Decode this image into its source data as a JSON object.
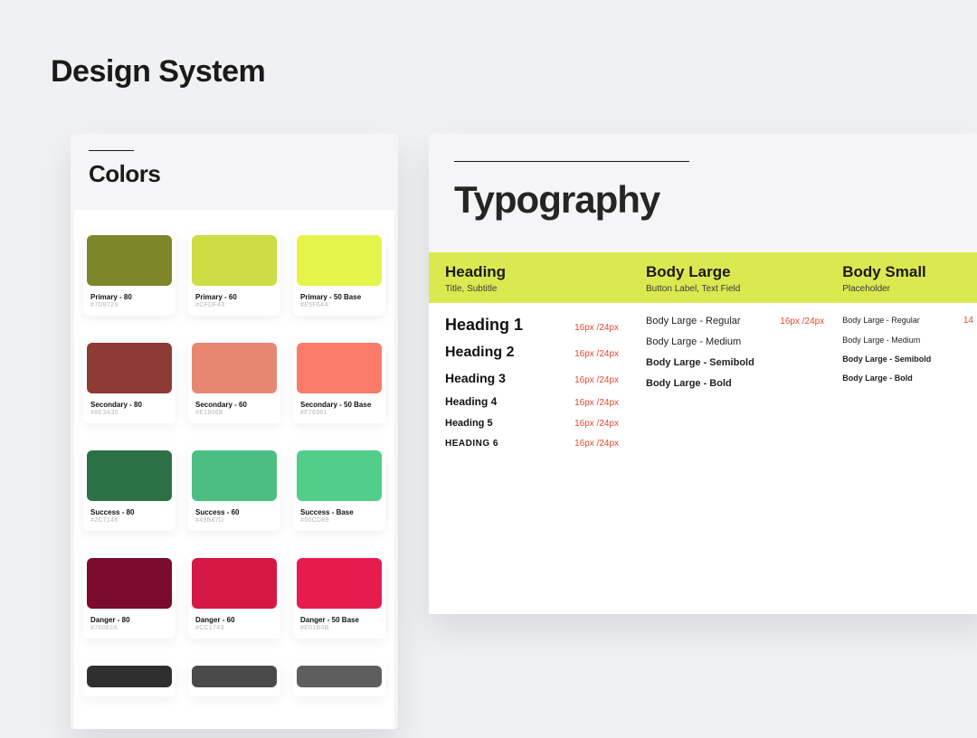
{
  "page_title": "Design System",
  "colors_section": {
    "title": "Colors",
    "rows": [
      [
        {
          "name": "Primary - 80",
          "hex": "#7D8729",
          "chip": "#7D8729"
        },
        {
          "name": "Primary - 60",
          "hex": "#CFDF43",
          "chip": "#CDDE44"
        },
        {
          "name": "Primary - 50 Base",
          "hex": "#E5F64A",
          "chip": "#E4F44B"
        }
      ],
      [
        {
          "name": "Secondary - 80",
          "hex": "#8E3A35",
          "chip": "#8E3A35"
        },
        {
          "name": "Secondary - 60",
          "hex": "#E1806B",
          "chip": "#E78772"
        },
        {
          "name": "Secondary - 50 Base",
          "hex": "#F76961",
          "chip": "#FA7B6A"
        }
      ],
      [
        {
          "name": "Success - 80",
          "hex": "#2C7146",
          "chip": "#2C7146"
        },
        {
          "name": "Success - 60",
          "hex": "#49B87D",
          "chip": "#4CBE82"
        },
        {
          "name": "Success - Base",
          "hex": "#50CD89",
          "chip": "#52CE8B"
        }
      ],
      [
        {
          "name": "Danger - 80",
          "hex": "#76082A",
          "chip": "#7A0B2C"
        },
        {
          "name": "Danger - 60",
          "hex": "#CC1743",
          "chip": "#D51846"
        },
        {
          "name": "Danger - 50 Base",
          "hex": "#E01B4B",
          "chip": "#E61C4E"
        }
      ]
    ],
    "dark_row": [
      {
        "chip": "#2F2F2F"
      },
      {
        "chip": "#4A4A4A"
      },
      {
        "chip": "#5E5E5E"
      }
    ]
  },
  "typography_section": {
    "title": "Typography",
    "columns": {
      "heading": {
        "title": "Heading",
        "sub": "Title, Subtitle"
      },
      "body_large": {
        "title": "Body Large",
        "sub": "Button Label, Text Field"
      },
      "body_small": {
        "title": "Body Small",
        "sub": "Placeholder"
      }
    },
    "headings": [
      {
        "label": "Heading 1",
        "meta": "16px /24px"
      },
      {
        "label": "Heading 2",
        "meta": "16px /24px"
      },
      {
        "label": "Heading 3",
        "meta": "16px /24px"
      },
      {
        "label": "Heading 4",
        "meta": "16px /24px"
      },
      {
        "label": "Heading 5",
        "meta": "16px /24px"
      },
      {
        "label": "HEADING 6",
        "meta": "16px /24px"
      }
    ],
    "body_large_rows": [
      {
        "label": "Body Large - Regular",
        "meta": "16px /24px"
      },
      {
        "label": "Body Large - Medium",
        "meta": ""
      },
      {
        "label": "Body Large - Semibold",
        "meta": ""
      },
      {
        "label": "Body Large - Bold",
        "meta": ""
      }
    ],
    "body_small_rows": [
      {
        "label": "Body Large - Regular",
        "meta": "14"
      },
      {
        "label": "Body Large - Medium",
        "meta": ""
      },
      {
        "label": "Body Large - Semibold",
        "meta": ""
      },
      {
        "label": "Body Large - Bold",
        "meta": ""
      }
    ]
  }
}
